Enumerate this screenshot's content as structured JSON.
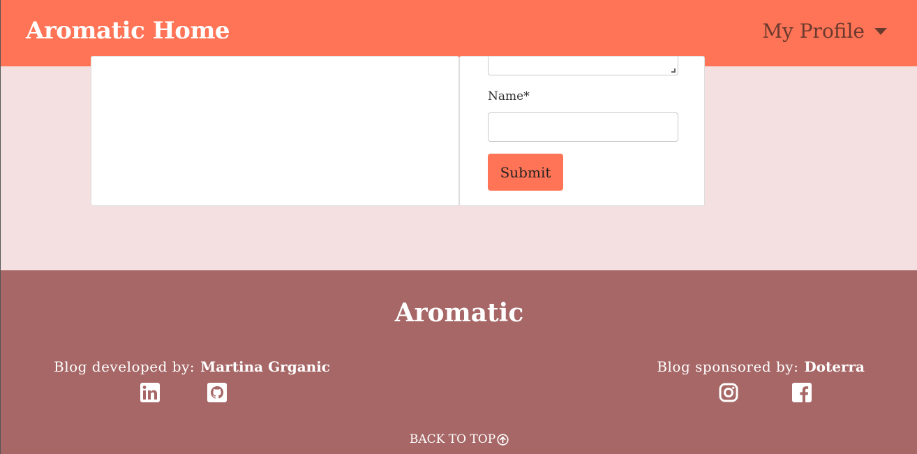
{
  "navbar": {
    "brand": "Aromatic Home",
    "profile_label": "My Profile",
    "profile_icon": "caret-down-icon"
  },
  "comment_form": {
    "name_label": "Name*",
    "name_value": "",
    "submit_label": "Submit"
  },
  "footer": {
    "title": "Aromatic",
    "developed_label": "Blog developed by:",
    "developer": "Martina Grganic",
    "sponsored_label": "Blog sponsored by:",
    "sponsor": "Doterra",
    "icons": [
      "linkedin-icon",
      "github-icon",
      "instagram-icon",
      "facebook-icon"
    ],
    "back_to_top": "BACK TO TOP"
  },
  "colors": {
    "navbar": "#ff7456",
    "page_bg": "#f4e0e0",
    "footer": "#a76767"
  }
}
